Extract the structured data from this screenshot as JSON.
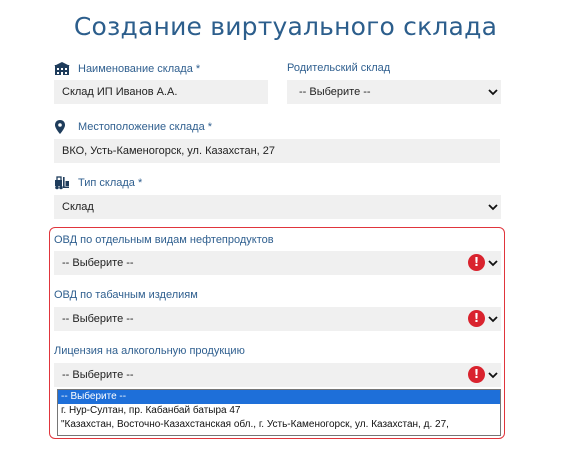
{
  "title": "Создание виртуального склада",
  "warehouse_name": {
    "label": "Наименование склада *",
    "value": "Склад ИП Иванов А.А.",
    "icon": "building-icon"
  },
  "parent_warehouse": {
    "label": "Родительский склад",
    "value": "-- Выберите --"
  },
  "location": {
    "label": "Местоположение склада *",
    "value": "ВКО, Усть-Каменогорск, ул. Казахстан, 27",
    "icon": "map-pin-icon"
  },
  "warehouse_type": {
    "label": "Тип склада *",
    "value": "Склад",
    "icon": "forklift-icon"
  },
  "ovd_oil": {
    "label": "ОВД по отдельным видам нефтепродуктов",
    "value": "-- Выберите --"
  },
  "ovd_tobacco": {
    "label": "ОВД по табачным изделиям",
    "value": "-- Выберите --"
  },
  "alcohol_license": {
    "label": "Лицензия на алкогольную продукцию",
    "value": "-- Выберите --",
    "options": [
      "-- Выберите --",
      "г. Нур-Султан, пр. Кабанбай батыра 47",
      "\"Казахстан, Восточно-Казахстанская обл., г. Усть-Каменогорск, ул. Казахстан, д. 27,"
    ]
  },
  "colors": {
    "accent": "#2f5f8f",
    "error": "#d9232e",
    "highlight_border": "#e0353c",
    "selected_option": "#1e6fd9"
  }
}
